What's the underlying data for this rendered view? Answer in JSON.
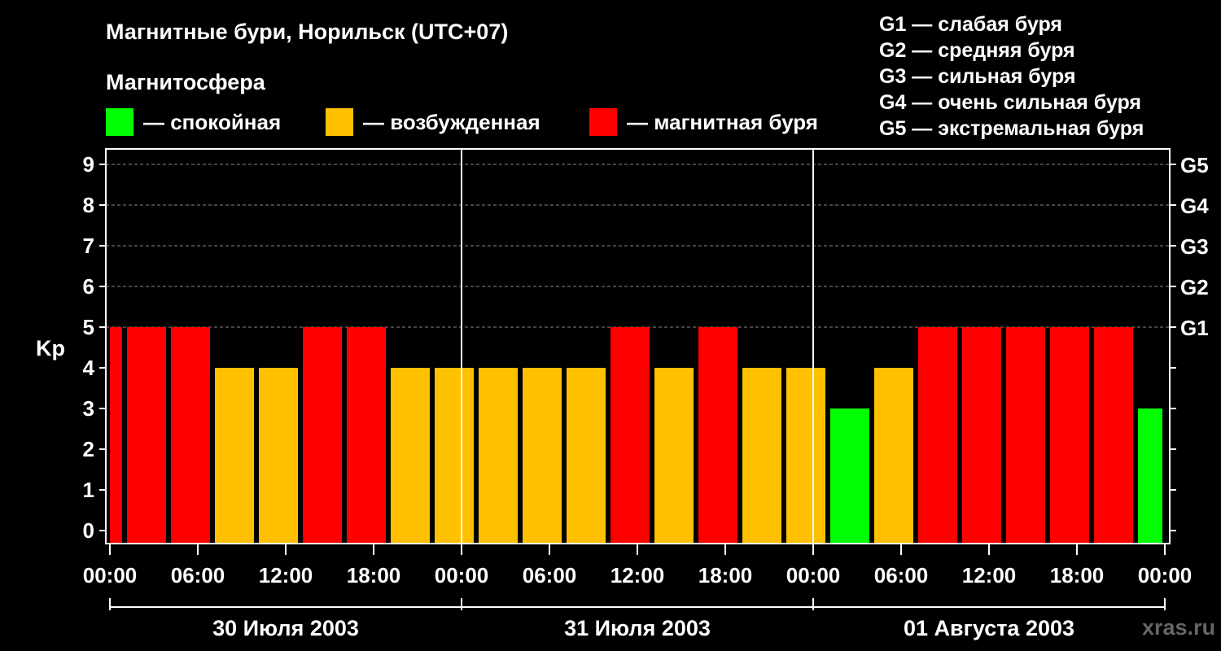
{
  "title": "Магнитные бури, Норильск (UTC+07)",
  "subtitle": "Магнитосфера",
  "legend": [
    {
      "color": "#00ff00",
      "label": "— спокойная"
    },
    {
      "color": "#ffc000",
      "label": "— возбужденная"
    },
    {
      "color": "#ff0000",
      "label": "— магнитная буря"
    }
  ],
  "g_legend": [
    "G1 — слабая буря",
    "G2 — средняя буря",
    "G3 — сильная буря",
    "G4 — очень сильная буря",
    "G5 — экстремальная буря"
  ],
  "watermark": "xras.ru",
  "chart_data": {
    "type": "bar",
    "ylabel": "Kp",
    "ylim": [
      0,
      9
    ],
    "yticks": [
      "0",
      "1",
      "2",
      "3",
      "4",
      "5",
      "6",
      "7",
      "8",
      "9"
    ],
    "right_ticks": [
      {
        "value": 5,
        "label": "G1"
      },
      {
        "value": 6,
        "label": "G2"
      },
      {
        "value": 7,
        "label": "G3"
      },
      {
        "value": 8,
        "label": "G4"
      },
      {
        "value": 9,
        "label": "G5"
      }
    ],
    "xticks": [
      "00:00",
      "06:00",
      "12:00",
      "18:00",
      "00:00",
      "06:00",
      "12:00",
      "18:00",
      "00:00",
      "06:00",
      "12:00",
      "18:00",
      "00:00"
    ],
    "days": [
      "30 Июля 2003",
      "31 Июля 2003",
      "01 Августа 2003"
    ],
    "grid": "horizontal dashed",
    "colors": {
      "quiet": "#00ff00",
      "active": "#ffc000",
      "storm": "#ff0000"
    },
    "bars": [
      {
        "start_hour": 0,
        "end_hour": 1,
        "kp": 5
      },
      {
        "start_hour": 1,
        "end_hour": 4,
        "kp": 5
      },
      {
        "start_hour": 4,
        "end_hour": 7,
        "kp": 5
      },
      {
        "start_hour": 7,
        "end_hour": 10,
        "kp": 4
      },
      {
        "start_hour": 10,
        "end_hour": 13,
        "kp": 4
      },
      {
        "start_hour": 13,
        "end_hour": 16,
        "kp": 5
      },
      {
        "start_hour": 16,
        "end_hour": 19,
        "kp": 5
      },
      {
        "start_hour": 19,
        "end_hour": 22,
        "kp": 4
      },
      {
        "start_hour": 22,
        "end_hour": 25,
        "kp": 4
      },
      {
        "start_hour": 25,
        "end_hour": 28,
        "kp": 4
      },
      {
        "start_hour": 28,
        "end_hour": 31,
        "kp": 4
      },
      {
        "start_hour": 31,
        "end_hour": 34,
        "kp": 4
      },
      {
        "start_hour": 34,
        "end_hour": 37,
        "kp": 5
      },
      {
        "start_hour": 37,
        "end_hour": 40,
        "kp": 4
      },
      {
        "start_hour": 40,
        "end_hour": 43,
        "kp": 5
      },
      {
        "start_hour": 43,
        "end_hour": 46,
        "kp": 4
      },
      {
        "start_hour": 46,
        "end_hour": 49,
        "kp": 4
      },
      {
        "start_hour": 49,
        "end_hour": 52,
        "kp": 3
      },
      {
        "start_hour": 52,
        "end_hour": 55,
        "kp": 4
      },
      {
        "start_hour": 55,
        "end_hour": 58,
        "kp": 5
      },
      {
        "start_hour": 58,
        "end_hour": 61,
        "kp": 5
      },
      {
        "start_hour": 61,
        "end_hour": 64,
        "kp": 5
      },
      {
        "start_hour": 64,
        "end_hour": 67,
        "kp": 5
      },
      {
        "start_hour": 67,
        "end_hour": 70,
        "kp": 5
      },
      {
        "start_hour": 70,
        "end_hour": 72,
        "kp": 3
      }
    ]
  }
}
